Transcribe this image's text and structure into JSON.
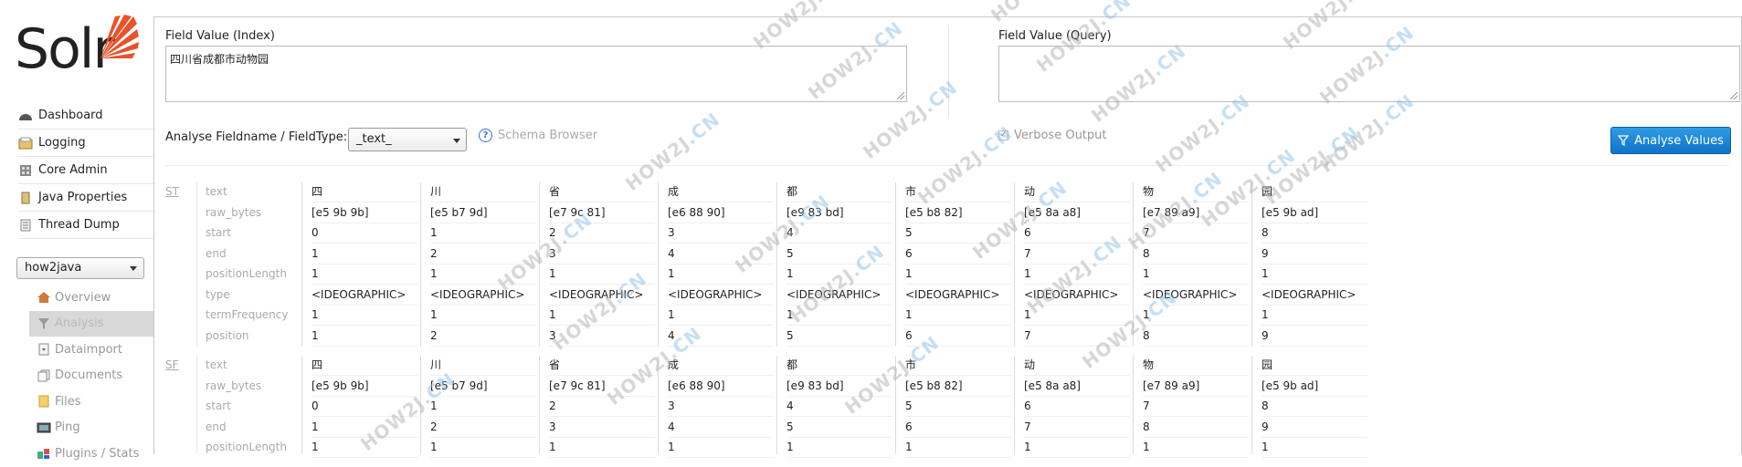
{
  "sidebar": {
    "logo_text": "Solr",
    "nav": [
      {
        "label": "Dashboard",
        "icon": "dashboard-icon"
      },
      {
        "label": "Logging",
        "icon": "logging-icon"
      },
      {
        "label": "Core Admin",
        "icon": "core-admin-icon"
      },
      {
        "label": "Java Properties",
        "icon": "java-properties-icon"
      },
      {
        "label": "Thread Dump",
        "icon": "thread-dump-icon"
      }
    ],
    "core_selector": {
      "value": "how2java"
    },
    "core_nav": [
      {
        "label": "Overview",
        "icon": "home-icon"
      },
      {
        "label": "Analysis",
        "icon": "funnel-icon"
      },
      {
        "label": "Dataimport",
        "icon": "dataimport-icon"
      },
      {
        "label": "Documents",
        "icon": "documents-icon"
      },
      {
        "label": "Files",
        "icon": "folder-icon"
      },
      {
        "label": "Ping",
        "icon": "ping-icon"
      },
      {
        "label": "Plugins / Stats",
        "icon": "plugins-icon"
      }
    ]
  },
  "analysis": {
    "index_label": "Field Value (Index)",
    "index_value": "四川省成都市动物园",
    "query_label": "Field Value (Query)",
    "query_value": "",
    "fieldtype_label": "Analyse Fieldname / FieldType:",
    "fieldtype_value": "_text_",
    "schema_browser": "Schema Browser",
    "verbose_label": "Verbose Output",
    "verbose_checked": true,
    "analyse_button": "Analyse Values"
  },
  "stages": [
    {
      "abbr": "ST",
      "attributes": [
        "text",
        "raw_bytes",
        "start",
        "end",
        "positionLength",
        "type",
        "termFrequency",
        "position"
      ],
      "tokens": [
        {
          "text": "四",
          "raw_bytes": "[e5 9b 9b]",
          "start": "0",
          "end": "1",
          "positionLength": "1",
          "type": "<IDEOGRAPHIC>",
          "termFrequency": "1",
          "position": "1"
        },
        {
          "text": "川",
          "raw_bytes": "[e5 b7 9d]",
          "start": "1",
          "end": "2",
          "positionLength": "1",
          "type": "<IDEOGRAPHIC>",
          "termFrequency": "1",
          "position": "2"
        },
        {
          "text": "省",
          "raw_bytes": "[e7 9c 81]",
          "start": "2",
          "end": "3",
          "positionLength": "1",
          "type": "<IDEOGRAPHIC>",
          "termFrequency": "1",
          "position": "3"
        },
        {
          "text": "成",
          "raw_bytes": "[e6 88 90]",
          "start": "3",
          "end": "4",
          "positionLength": "1",
          "type": "<IDEOGRAPHIC>",
          "termFrequency": "1",
          "position": "4"
        },
        {
          "text": "都",
          "raw_bytes": "[e9 83 bd]",
          "start": "4",
          "end": "5",
          "positionLength": "1",
          "type": "<IDEOGRAPHIC>",
          "termFrequency": "1",
          "position": "5"
        },
        {
          "text": "市",
          "raw_bytes": "[e5 b8 82]",
          "start": "5",
          "end": "6",
          "positionLength": "1",
          "type": "<IDEOGRAPHIC>",
          "termFrequency": "1",
          "position": "6"
        },
        {
          "text": "动",
          "raw_bytes": "[e5 8a a8]",
          "start": "6",
          "end": "7",
          "positionLength": "1",
          "type": "<IDEOGRAPHIC>",
          "termFrequency": "1",
          "position": "7"
        },
        {
          "text": "物",
          "raw_bytes": "[e7 89 a9]",
          "start": "7",
          "end": "8",
          "positionLength": "1",
          "type": "<IDEOGRAPHIC>",
          "termFrequency": "1",
          "position": "8"
        },
        {
          "text": "园",
          "raw_bytes": "[e5 9b ad]",
          "start": "8",
          "end": "9",
          "positionLength": "1",
          "type": "<IDEOGRAPHIC>",
          "termFrequency": "1",
          "position": "9"
        }
      ]
    },
    {
      "abbr": "SF",
      "attributes": [
        "text",
        "raw_bytes",
        "start",
        "end",
        "positionLength"
      ],
      "tokens": [
        {
          "text": "四",
          "raw_bytes": "[e5 9b 9b]",
          "start": "0",
          "end": "1",
          "positionLength": "1"
        },
        {
          "text": "川",
          "raw_bytes": "[e5 b7 9d]",
          "start": "1",
          "end": "2",
          "positionLength": "1"
        },
        {
          "text": "省",
          "raw_bytes": "[e7 9c 81]",
          "start": "2",
          "end": "3",
          "positionLength": "1"
        },
        {
          "text": "成",
          "raw_bytes": "[e6 88 90]",
          "start": "3",
          "end": "4",
          "positionLength": "1"
        },
        {
          "text": "都",
          "raw_bytes": "[e9 83 bd]",
          "start": "4",
          "end": "5",
          "positionLength": "1"
        },
        {
          "text": "市",
          "raw_bytes": "[e5 b8 82]",
          "start": "5",
          "end": "6",
          "positionLength": "1"
        },
        {
          "text": "动",
          "raw_bytes": "[e5 8a a8]",
          "start": "6",
          "end": "7",
          "positionLength": "1"
        },
        {
          "text": "物",
          "raw_bytes": "[e7 89 a9]",
          "start": "7",
          "end": "8",
          "positionLength": "1"
        },
        {
          "text": "园",
          "raw_bytes": "[e5 9b ad]",
          "start": "8",
          "end": "9",
          "positionLength": "1"
        }
      ]
    }
  ],
  "watermark": {
    "part1": "HOW2J",
    "part2": ".CN"
  },
  "colors": {
    "accent": "#0f72c8",
    "logo_orange": "#e8522a",
    "watermark_blue": "#8fc0e8"
  }
}
